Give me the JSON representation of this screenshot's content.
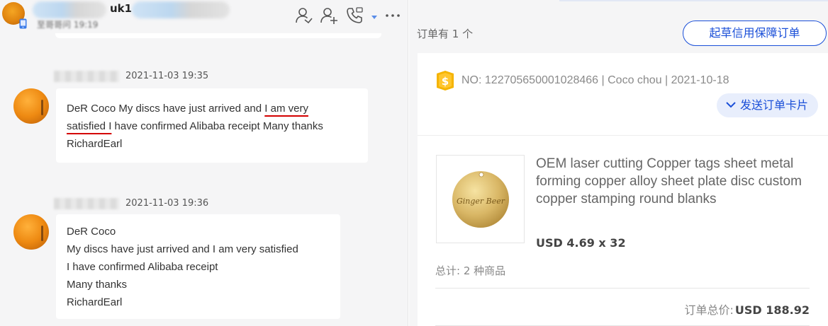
{
  "chat": {
    "header": {
      "contact_name_visible": "uk1",
      "status_text": "至哥哥问 19:19"
    },
    "messages": [
      {
        "time": "2021-11-03 19:35",
        "text_before": "DeR Coco My discs have just arrived and ",
        "text_underlined_1": "I am very",
        "text_underlined_2": "satisfied I",
        "text_after": " have confirmed Alibaba receipt Many thanks RichardEarl"
      },
      {
        "time": "2021-11-03 19:36",
        "lines": [
          "DeR Coco",
          "My discs have just arrived and I am very satisfied",
          "I have confirmed Alibaba receipt",
          "Many thanks",
          "RichardEarl"
        ]
      }
    ]
  },
  "order_panel": {
    "order_count_label": "订单有 1 个",
    "draft_button_label": "起草信用保障订单",
    "order": {
      "number_line": "NO: 122705650001028466 | Coco chou | 2021-10-18",
      "send_card_label": "发送订单卡片",
      "product_title": "OEM laser cutting Copper tags sheet metal forming copper alloy sheet plate disc custom copper stamping round blanks",
      "product_price": "USD 4.69 x 32",
      "product_thumb_text": "Ginger Beer",
      "total_items_label": "总计: 2 种商品",
      "grand_total_label": "订单总价:",
      "grand_total_value": "USD 188.92"
    }
  },
  "colors": {
    "accent_blue": "#1a4fd8",
    "send_card_bg": "#e8eefc",
    "underline_red": "#d40000",
    "coin_gold": "#f5b400"
  }
}
